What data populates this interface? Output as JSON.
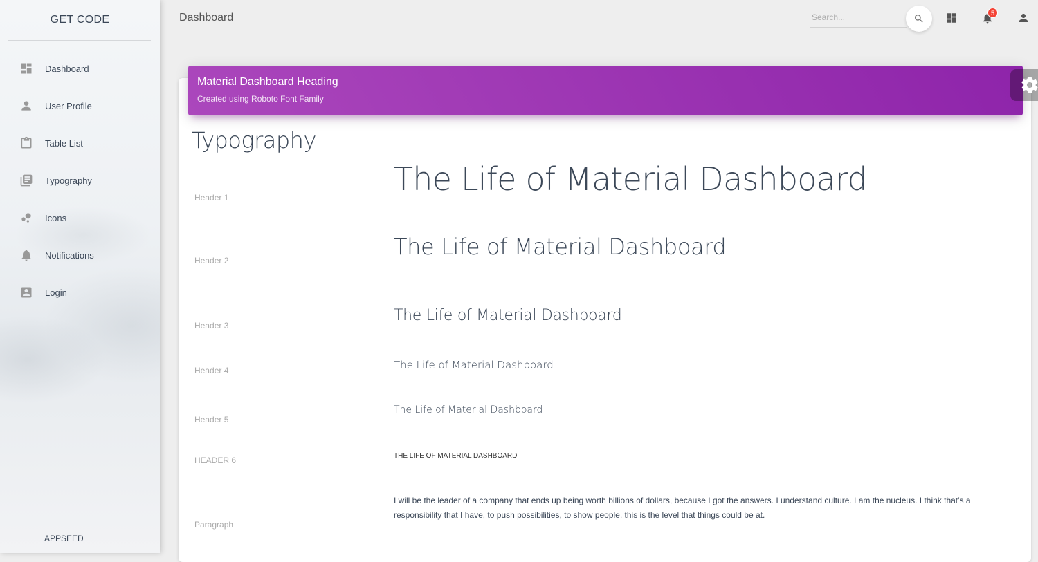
{
  "sidebar": {
    "brand": "GET CODE",
    "items": [
      {
        "label": "Dashboard",
        "icon": "dashboard-icon"
      },
      {
        "label": "User Profile",
        "icon": "person-icon"
      },
      {
        "label": "Table List",
        "icon": "clipboard-icon"
      },
      {
        "label": "Typography",
        "icon": "library-books-icon"
      },
      {
        "label": "Icons",
        "icon": "bubble-chart-icon"
      },
      {
        "label": "Notifications",
        "icon": "bell-icon"
      },
      {
        "label": "Login",
        "icon": "account-box-icon"
      }
    ],
    "footer": "APPSEED"
  },
  "topbar": {
    "title": "Dashboard",
    "search_placeholder": "Search...",
    "notification_count": "5"
  },
  "card": {
    "title": "Material Dashboard Heading",
    "category": "Created using Roboto Font Family"
  },
  "typography": {
    "title": "Typography",
    "rows": [
      {
        "label": "Header 1",
        "text": "The Life of Material Dashboard"
      },
      {
        "label": "Header 2",
        "text": "The Life of Material Dashboard"
      },
      {
        "label": "Header 3",
        "text": "The Life of Material Dashboard"
      },
      {
        "label": "Header 4",
        "text": "The Life of Material Dashboard"
      },
      {
        "label": "Header 5",
        "text": "The Life of Material Dashboard"
      },
      {
        "label": "HEADER 6",
        "text": "The Life of Material Dashboard"
      },
      {
        "label": "Paragraph",
        "text": "I will be the leader of a company that ends up being worth billions of dollars, because I got the answers. I understand culture. I am the nucleus. I think that’s a responsibility that I have, to push possibilities, to show people, this is the level that things could be at."
      }
    ]
  },
  "colors": {
    "accent": "#9c27b0",
    "badge": "#f44336",
    "text": "#3c4858",
    "muted": "#aaaaaa"
  }
}
